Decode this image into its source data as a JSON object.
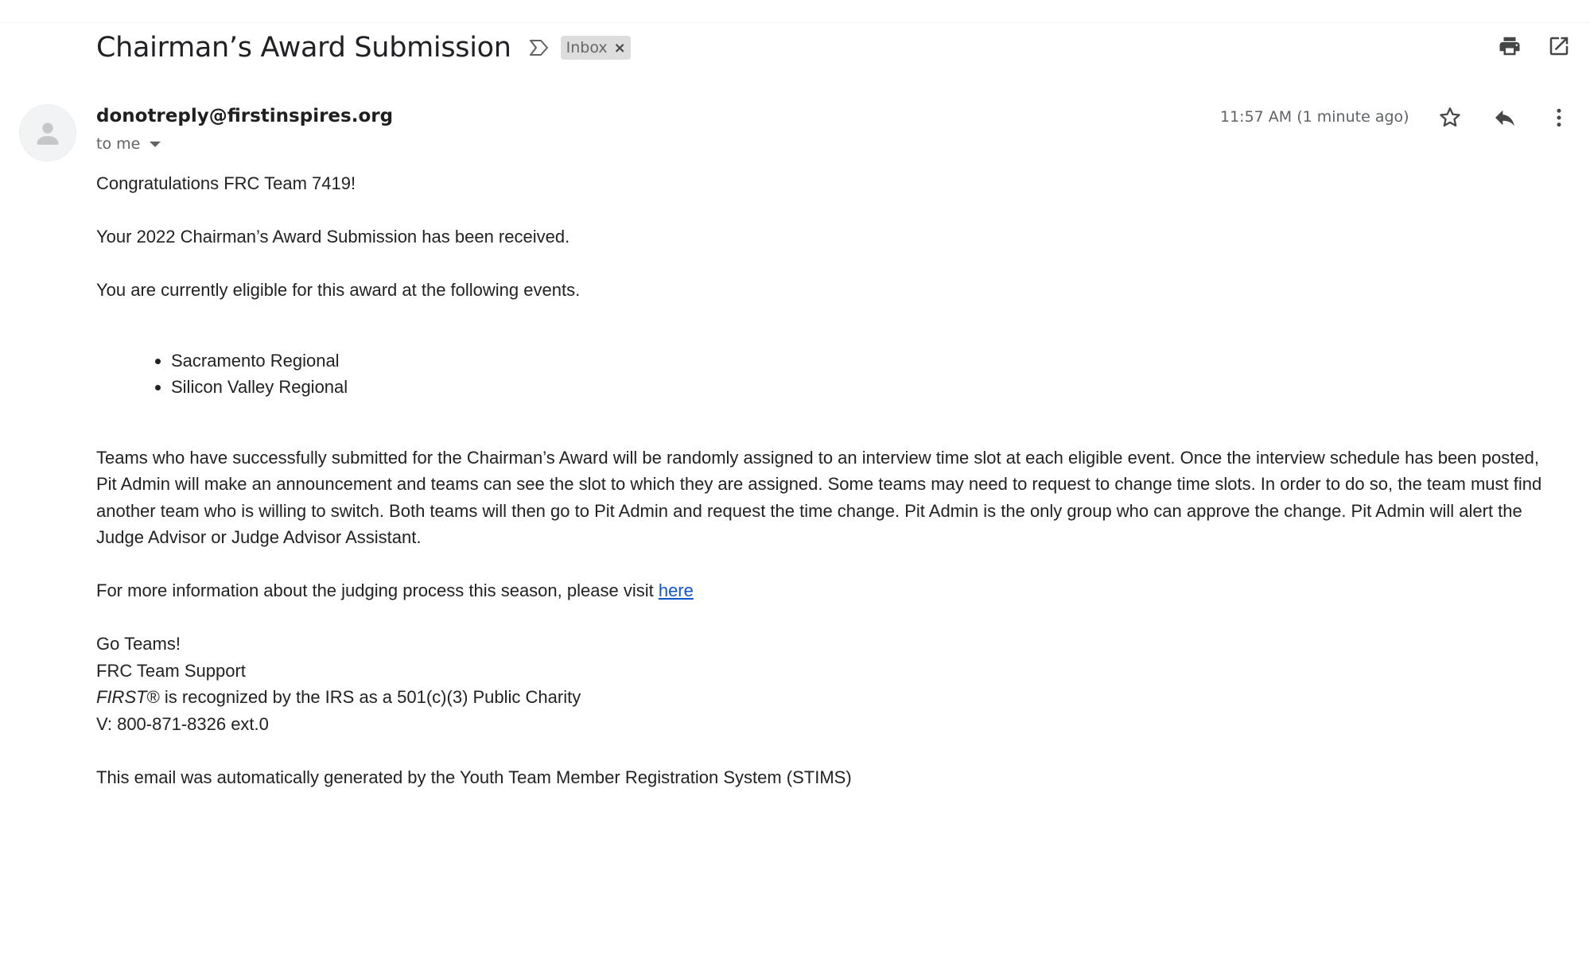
{
  "email": {
    "subject": "Chairman’s Award Submission",
    "label_chip": "Inbox",
    "sender": "donotreply@firstinspires.org",
    "recipient_label": "to me",
    "timestamp": "11:57 AM (1 minute ago)"
  },
  "icons": {
    "importance": "importance-marker-icon",
    "chip_close": "close-icon",
    "print": "print-icon",
    "new_window": "open-in-new-window-icon",
    "avatar": "person-avatar-icon",
    "star": "star-icon",
    "reply": "reply-icon",
    "more": "more-vertical-icon"
  },
  "body": {
    "greeting": "Congratulations FRC Team 7419!",
    "received": "Your 2022 Chairman’s Award Submission has been received.",
    "eligible_intro": "You are currently eligible for this award at the following events.",
    "events": [
      "Sacramento Regional",
      "Silicon Valley Regional"
    ],
    "interview_paragraph": "Teams who have successfully submitted for the Chairman’s Award will be randomly assigned to an interview time slot at each eligible event. Once the interview schedule has been posted, Pit Admin will make an announcement and teams can see the slot to which they are assigned. Some teams may need to request to change time slots. In order to do so, the team must find another team who is willing to switch. Both teams will then go to Pit Admin and request the time change. Pit Admin is the only group who can approve the change. Pit Admin will alert the Judge Advisor or Judge Advisor Assistant.",
    "info_text": "For more information about the judging process this season, please visit ",
    "info_link": "here",
    "sign_off": "Go Teams!",
    "signature_team": "FRC Team Support",
    "charity_first": "FIRST",
    "charity_rest": "® is recognized by the IRS as a 501(c)(3) Public Charity",
    "phone": "V: 800-871-8326 ext.0",
    "footer": "This email was automatically generated by the Youth Team Member Registration System (STIMS)"
  }
}
